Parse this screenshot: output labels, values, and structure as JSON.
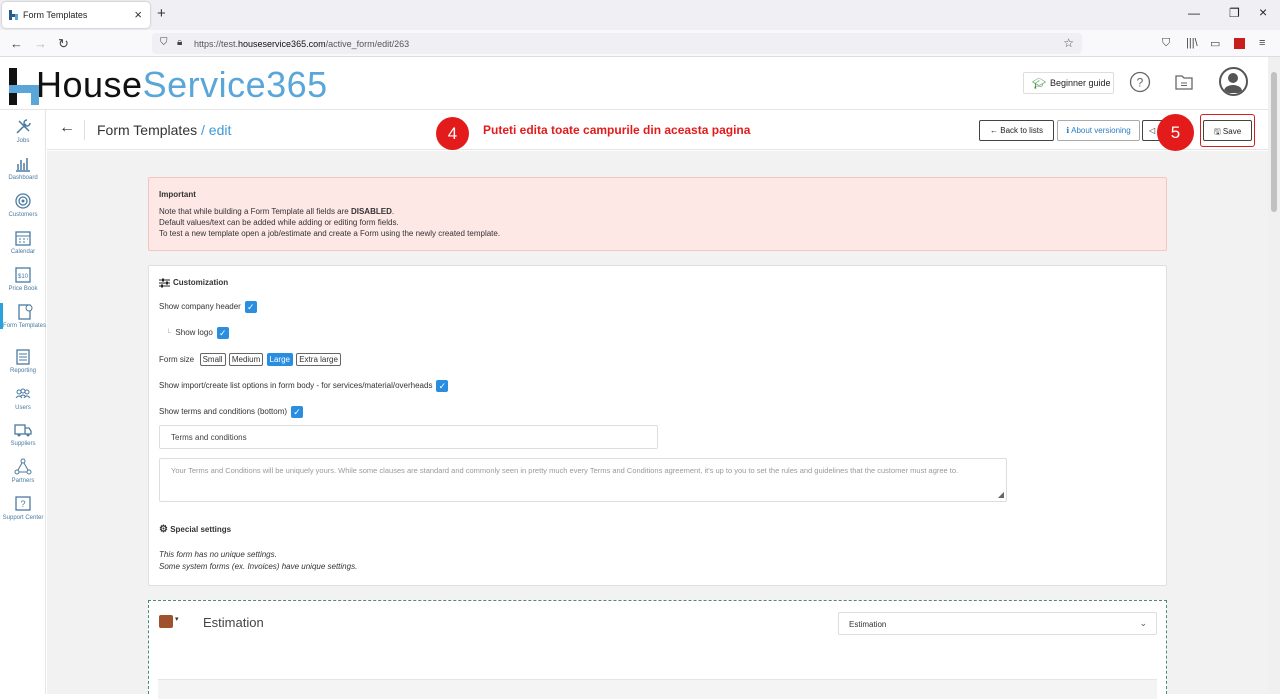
{
  "browser": {
    "tab_title": "Form Templates",
    "url_prefix": "https://test.",
    "url_domain": "houseservice365.com",
    "url_path": "/active_form/edit/263"
  },
  "header": {
    "logo_dark": "House",
    "logo_light": "Service365",
    "beginner_guide": "Beginner guide"
  },
  "sidebar": {
    "items": [
      {
        "label": "Jobs",
        "icon": "tools-icon"
      },
      {
        "label": "Dashboard",
        "icon": "bar-chart-icon"
      },
      {
        "label": "Customers",
        "icon": "target-icon"
      },
      {
        "label": "Calendar",
        "icon": "calendar-icon"
      },
      {
        "label": "Price Book",
        "icon": "price-tag-icon",
        "badge": "$10"
      },
      {
        "label": "Form Templates",
        "icon": "form-icon"
      },
      {
        "label": "Reporting",
        "icon": "report-icon"
      },
      {
        "label": "Users",
        "icon": "users-icon"
      },
      {
        "label": "Suppliers",
        "icon": "truck-icon"
      },
      {
        "label": "Partners",
        "icon": "network-icon"
      },
      {
        "label": "Support Center",
        "icon": "help-box-icon",
        "badge": "?"
      }
    ]
  },
  "titlebar": {
    "title": "Form Templates",
    "title_sep": " / ",
    "title_edit": "edit",
    "callout_4": "4",
    "annotation": "Puteti edita toate campurile din aceasta pagina",
    "back_to_lists": "Back to lists",
    "about_versioning": "About versioning",
    "callout_5": "5",
    "save": "Save"
  },
  "alert": {
    "heading": "Important",
    "line1_pre": "Note that while building a Form Template all fields are ",
    "line1_bold": "DISABLED",
    "line1_post": ".",
    "line2": "Default values/text can be added while adding or editing form fields.",
    "line3": "To test a new template open a job/estimate and create a Form using the newly created template."
  },
  "customization": {
    "heading": "Customization",
    "show_company_header": "Show company header",
    "show_logo": "Show logo",
    "form_size_label": "Form size",
    "sizes": [
      "Small",
      "Medium",
      "Large",
      "Extra large"
    ],
    "selected_size": "Large",
    "show_import": "Show import/create list options in form body - for services/material/overheads",
    "show_terms": "Show terms and conditions (bottom)",
    "terms_title_value": "Terms and conditions",
    "terms_placeholder": "Your Terms and Conditions will be uniquely yours. While some clauses are standard and commonly seen in pretty much every Terms and Conditions agreement, it's up to you to set the rules and guidelines that the customer must agree to.",
    "special_heading": "Special settings",
    "special_line1": "This form has no unique settings.",
    "special_line2": "Some system forms (ex. Invoices) have unique settings."
  },
  "section": {
    "title": "Estimation",
    "select_value": "Estimation",
    "swatch_color": "#a0522d"
  },
  "colors": {
    "accent": "#2a8ee0",
    "callout": "#e31b1b",
    "link": "#3c9ad6"
  }
}
